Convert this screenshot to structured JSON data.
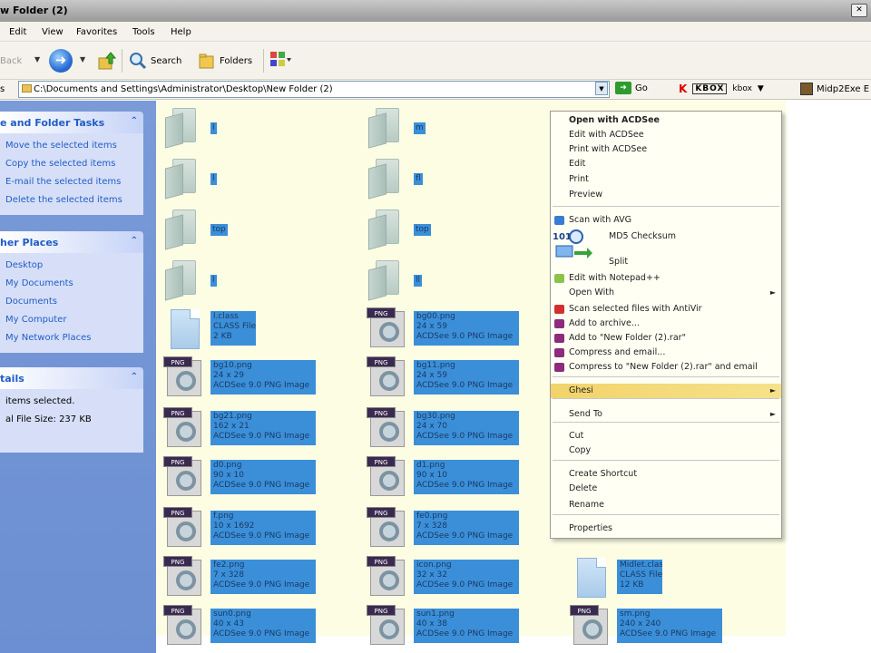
{
  "window": {
    "title": "w Folder (2)"
  },
  "menubar": [
    "Edit",
    "View",
    "Favorites",
    "Tools",
    "Help"
  ],
  "toolbar": {
    "back": "Back",
    "search": "Search",
    "folders": "Folders"
  },
  "address": {
    "label": "s",
    "path": "C:\\Documents and Settings\\Administrator\\Desktop\\New Folder (2)",
    "go": "Go",
    "kbox": "KBOX",
    "kbox_suffix": "kbox",
    "midp": "Midp2Exe E"
  },
  "left_pane": {
    "tasks": {
      "title": "e and Folder Tasks",
      "items": [
        "Move the selected items",
        "Copy the selected items",
        "E-mail the selected items",
        "Delete the selected items"
      ]
    },
    "places": {
      "title": "her Places",
      "items": [
        "Desktop",
        "My Documents",
        "Documents",
        "My Computer",
        "My Network Places"
      ]
    },
    "details": {
      "title": "tails",
      "line1": "items selected.",
      "line2": "al File Size: 237 KB"
    }
  },
  "files": [
    {
      "name": "l",
      "kind": "folder"
    },
    {
      "name": "m",
      "kind": "folder"
    },
    {
      "name": "l",
      "kind": "folder"
    },
    {
      "name": "fl",
      "kind": "folder"
    },
    {
      "name": "top",
      "kind": "folder"
    },
    {
      "name": "top",
      "kind": "folder"
    },
    {
      "name": "l",
      "kind": "folder"
    },
    {
      "name": "ll",
      "kind": "folder"
    },
    {
      "name": "l.class",
      "kind": "class",
      "line2": "CLASS File",
      "line3": "2 KB"
    },
    {
      "name": "bg00.png",
      "kind": "png",
      "line2": "24 x 59",
      "line3": "ACDSee 9.0 PNG Image"
    },
    {
      "name": "bg10.png",
      "kind": "png",
      "line2": "24 x 29",
      "line3": "ACDSee 9.0 PNG Image"
    },
    {
      "name": "bg11.png",
      "kind": "png",
      "line2": "24 x 59",
      "line3": "ACDSee 9.0 PNG Image"
    },
    {
      "name": "bg21.png",
      "kind": "png",
      "line2": "162 x 21",
      "line3": "ACDSee 9.0 PNG Image"
    },
    {
      "name": "bg30.png",
      "kind": "png",
      "line2": "24 x 70",
      "line3": "ACDSee 9.0 PNG Image"
    },
    {
      "name": "d0.png",
      "kind": "png",
      "line2": "90 x 10",
      "line3": "ACDSee 9.0 PNG Image"
    },
    {
      "name": "d1.png",
      "kind": "png",
      "line2": "90 x 10",
      "line3": "ACDSee 9.0 PNG Image"
    },
    {
      "name": "f.png",
      "kind": "png",
      "line2": "10 x 1692",
      "line3": "ACDSee 9.0 PNG Image"
    },
    {
      "name": "fe0.png",
      "kind": "png",
      "line2": "7 x 328",
      "line3": "ACDSee 9.0 PNG Image"
    },
    {
      "name": "fe2.png",
      "kind": "png",
      "line2": "7 x 328",
      "line3": "ACDSee 9.0 PNG Image"
    },
    {
      "name": "icon.png",
      "kind": "png",
      "line2": "32 x 32",
      "line3": "ACDSee 9.0 PNG Image"
    },
    {
      "name": "Midlet.class",
      "kind": "class",
      "line2": "CLASS File",
      "line3": "12 KB"
    },
    {
      "name": "sun0.png",
      "kind": "png",
      "line2": "40 x 43",
      "line3": "ACDSee 9.0 PNG Image"
    },
    {
      "name": "sun1.png",
      "kind": "png",
      "line2": "40 x 38",
      "line3": "ACDSee 9.0 PNG Image"
    },
    {
      "name": "sm.png",
      "kind": "png",
      "line2": "240 x 240",
      "line3": "ACDSee 9.0 PNG Image"
    }
  ],
  "context_menu": {
    "items": [
      {
        "label": "Open with ACDSee",
        "bold": true
      },
      {
        "label": "Edit with ACDSee"
      },
      {
        "label": "Print with ACDSee"
      },
      {
        "label": "Edit"
      },
      {
        "label": "Print"
      },
      {
        "label": "Preview"
      },
      {
        "label": "Scan with AVG",
        "icon": "avg-icon"
      },
      {
        "label": "MD5 Checksum",
        "icon": "md5-icon"
      },
      {
        "label": "Split",
        "icon": "split-icon"
      },
      {
        "label": "Edit with Notepad++",
        "icon": "notepad-icon"
      },
      {
        "label": "Open With",
        "submenu": true
      },
      {
        "label": "Scan selected files with AntiVir",
        "icon": "antivir-icon"
      },
      {
        "label": "Add to archive...",
        "icon": "rar-icon"
      },
      {
        "label": "Add to \"New Folder (2).rar\"",
        "icon": "rar-icon"
      },
      {
        "label": "Compress and email...",
        "icon": "rar-icon"
      },
      {
        "label": "Compress to \"New Folder (2).rar\" and email",
        "icon": "rar-icon"
      },
      {
        "label": "Ghesi",
        "submenu": true,
        "highlighted": true
      },
      {
        "label": "Send To",
        "submenu": true
      },
      {
        "label": "Cut"
      },
      {
        "label": "Copy"
      },
      {
        "label": "Create Shortcut"
      },
      {
        "label": "Delete"
      },
      {
        "label": "Rename"
      },
      {
        "label": "Properties"
      }
    ]
  },
  "colors": {
    "selection": "#3b8fd8",
    "pane_blue": "#6b8fd2",
    "link": "#215dc6",
    "menu_highlight": "#f2d36b"
  }
}
